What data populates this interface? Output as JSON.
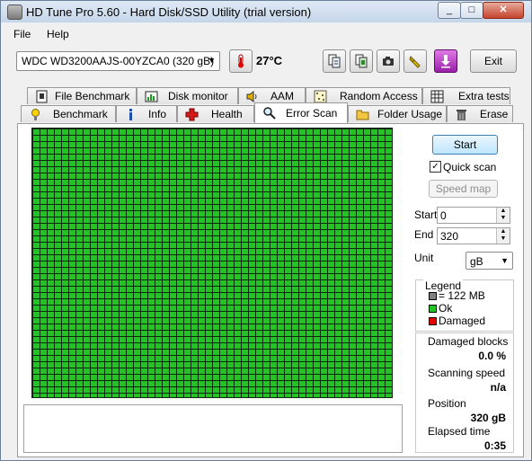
{
  "window": {
    "title": "HD Tune Pro 5.60 - Hard Disk/SSD Utility (trial version)",
    "minimize_glyph": "_",
    "maximize_glyph": "□",
    "close_glyph": "✕"
  },
  "menu": {
    "file": "File",
    "help": "Help"
  },
  "toolbar": {
    "drive": "WDC WD3200AAJS-00YZCA0 (320 gB)",
    "temperature": "27°C",
    "exit_label": "Exit",
    "icons": [
      "copy-info-icon",
      "copy-screen-icon",
      "screenshot-icon",
      "options-icon",
      "save-icon"
    ]
  },
  "tabs_row1": [
    {
      "label": "File Benchmark",
      "icon": "file-benchmark-icon"
    },
    {
      "label": "Disk monitor",
      "icon": "disk-monitor-icon"
    },
    {
      "label": "AAM",
      "icon": "aam-icon"
    },
    {
      "label": "Random Access",
      "icon": "random-access-icon"
    },
    {
      "label": "Extra tests",
      "icon": "extra-tests-icon"
    }
  ],
  "tabs_row2": [
    {
      "label": "Benchmark",
      "icon": "benchmark-icon"
    },
    {
      "label": "Info",
      "icon": "info-icon"
    },
    {
      "label": "Health",
      "icon": "health-icon"
    },
    {
      "label": "Error Scan",
      "icon": "search-icon"
    },
    {
      "label": "Folder Usage",
      "icon": "folder-icon"
    },
    {
      "label": "Erase",
      "icon": "trash-icon"
    }
  ],
  "scan": {
    "start_button": "Start",
    "quick_scan_label": "Quick scan",
    "quick_scan_checked": true,
    "speed_map_button": "Speed map",
    "start_label": "Start",
    "start_value": "0",
    "end_label": "End",
    "end_value": "320",
    "unit_label": "Unit",
    "unit_value": "gB",
    "block_color_ok": "#22c322"
  },
  "legend": {
    "title": "Legend",
    "block_size": "= 122 MB",
    "ok": "Ok",
    "damaged": "Damaged",
    "colors": {
      "block": "#808080",
      "ok": "#22c322",
      "damaged": "#e00000"
    }
  },
  "stats": {
    "damaged_blocks_label": "Damaged blocks",
    "damaged_blocks_value": "0.0 %",
    "scanning_speed_label": "Scanning speed",
    "scanning_speed_value": "n/a",
    "position_label": "Position",
    "position_value": "320 gB",
    "elapsed_time_label": "Elapsed time",
    "elapsed_time_value": "0:35"
  }
}
